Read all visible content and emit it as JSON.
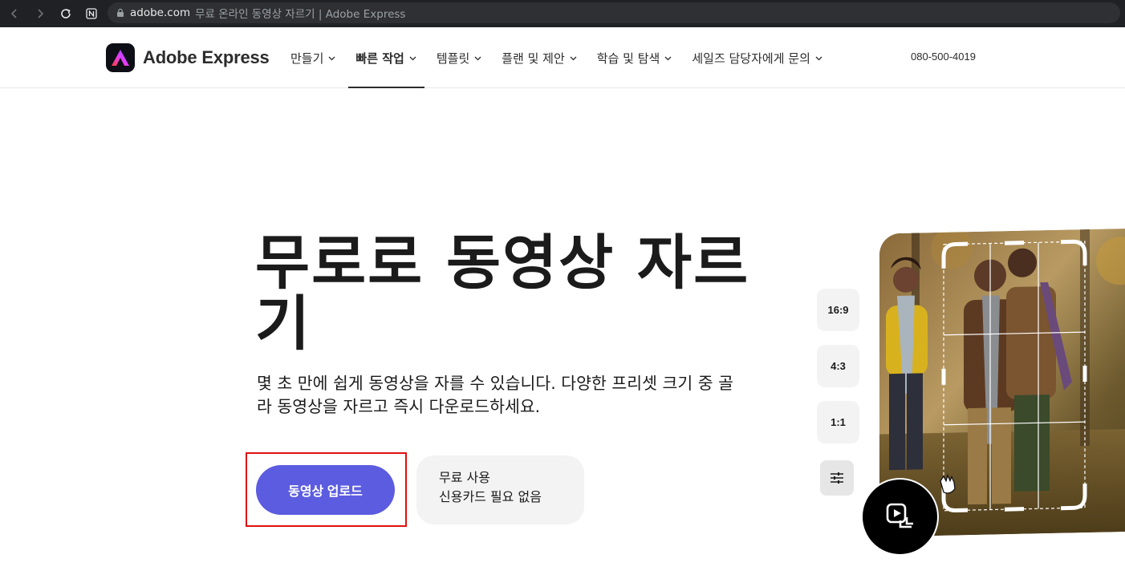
{
  "browser": {
    "url_domain": "adobe.com",
    "url_title": "무료 온라인 동영상 자르기 | Adobe Express"
  },
  "header": {
    "logo_text": "Adobe Express",
    "nav": [
      {
        "label": "만들기"
      },
      {
        "label": "빠른 작업"
      },
      {
        "label": "템플릿"
      },
      {
        "label": "플랜 및 제안"
      },
      {
        "label": "학습 및 탐색"
      },
      {
        "label": "세일즈 담당자에게 문의"
      }
    ],
    "phone": "080-500-4019"
  },
  "hero": {
    "title": "무로로 동영상 자르기",
    "description": "몇 초 만에 쉽게 동영상을 자를 수 있습니다. 다양한 프리셋 크기 중 골라 동영상을 자르고 즉시 다운로드하세요.",
    "upload_label": "동영상 업로드",
    "free_line1": "무료 사용",
    "free_line2": "신용카드 필요 없음"
  },
  "ratios": {
    "r1": "16:9",
    "r2": "4:3",
    "r3": "1:1"
  },
  "icons": [
    "back-icon",
    "forward-icon",
    "reload-icon",
    "notion-icon",
    "lock-icon",
    "chevron-down-icon",
    "adobe-express-logo-icon",
    "sliders-icon",
    "video-crop-icon",
    "grab-hand-icon"
  ],
  "colors": {
    "primary_button": "#5c5ce0",
    "highlight_border": "#e01010",
    "browser_bar": "#202124"
  }
}
